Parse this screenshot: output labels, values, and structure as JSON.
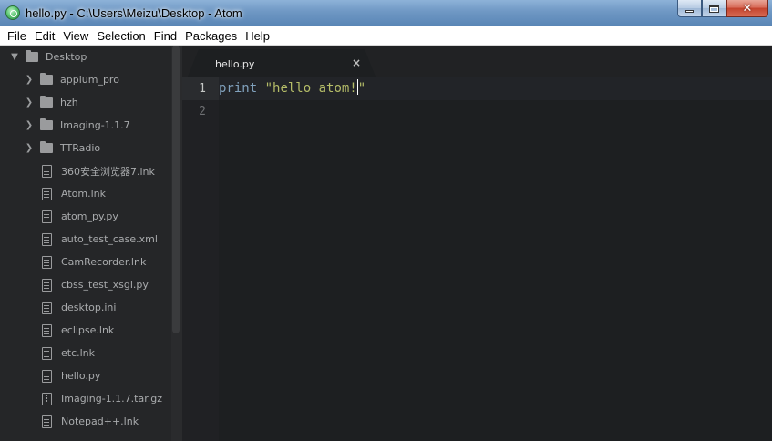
{
  "window": {
    "title": "hello.py - C:\\Users\\Meizu\\Desktop - Atom",
    "controls": {
      "minimize_icon": "minimize-icon",
      "maximize_icon": "maximize-icon",
      "close_glyph": "✕"
    }
  },
  "menu": [
    "File",
    "Edit",
    "View",
    "Selection",
    "Find",
    "Packages",
    "Help"
  ],
  "tree": {
    "root": {
      "label": "Desktop",
      "expanded": true
    },
    "folders": [
      {
        "label": "appium_pro"
      },
      {
        "label": "hzh"
      },
      {
        "label": "Imaging-1.1.7"
      },
      {
        "label": "TTRadio"
      }
    ],
    "files": [
      {
        "label": "360安全浏览器7.lnk",
        "icon": "file-text-icon"
      },
      {
        "label": "Atom.lnk",
        "icon": "file-text-icon"
      },
      {
        "label": "atom_py.py",
        "icon": "file-text-icon"
      },
      {
        "label": "auto_test_case.xml",
        "icon": "file-text-icon"
      },
      {
        "label": "CamRecorder.lnk",
        "icon": "file-text-icon"
      },
      {
        "label": "cbss_test_xsgl.py",
        "icon": "file-text-icon"
      },
      {
        "label": "desktop.ini",
        "icon": "file-text-icon"
      },
      {
        "label": "eclipse.lnk",
        "icon": "file-text-icon"
      },
      {
        "label": "etc.lnk",
        "icon": "file-text-icon"
      },
      {
        "label": "hello.py",
        "icon": "file-text-icon"
      },
      {
        "label": "Imaging-1.1.7.tar.gz",
        "icon": "file-zip-icon"
      },
      {
        "label": "Notepad++.lnk",
        "icon": "file-text-icon"
      }
    ]
  },
  "tabs": [
    {
      "label": "hello.py",
      "close": "×",
      "active": true
    }
  ],
  "editor": {
    "line_numbers": [
      "1",
      "2"
    ],
    "lines": [
      {
        "keyword": "print",
        "space": " ",
        "string": "\"hello atom!",
        "after_caret": "\""
      },
      {
        "keyword": "",
        "space": "",
        "string": "",
        "after_caret": ""
      }
    ]
  },
  "colors": {
    "keyword": "#81a2be",
    "string": "#b5bd68",
    "editor_bg": "#1d1f21",
    "treeview_bg": "#252628"
  }
}
